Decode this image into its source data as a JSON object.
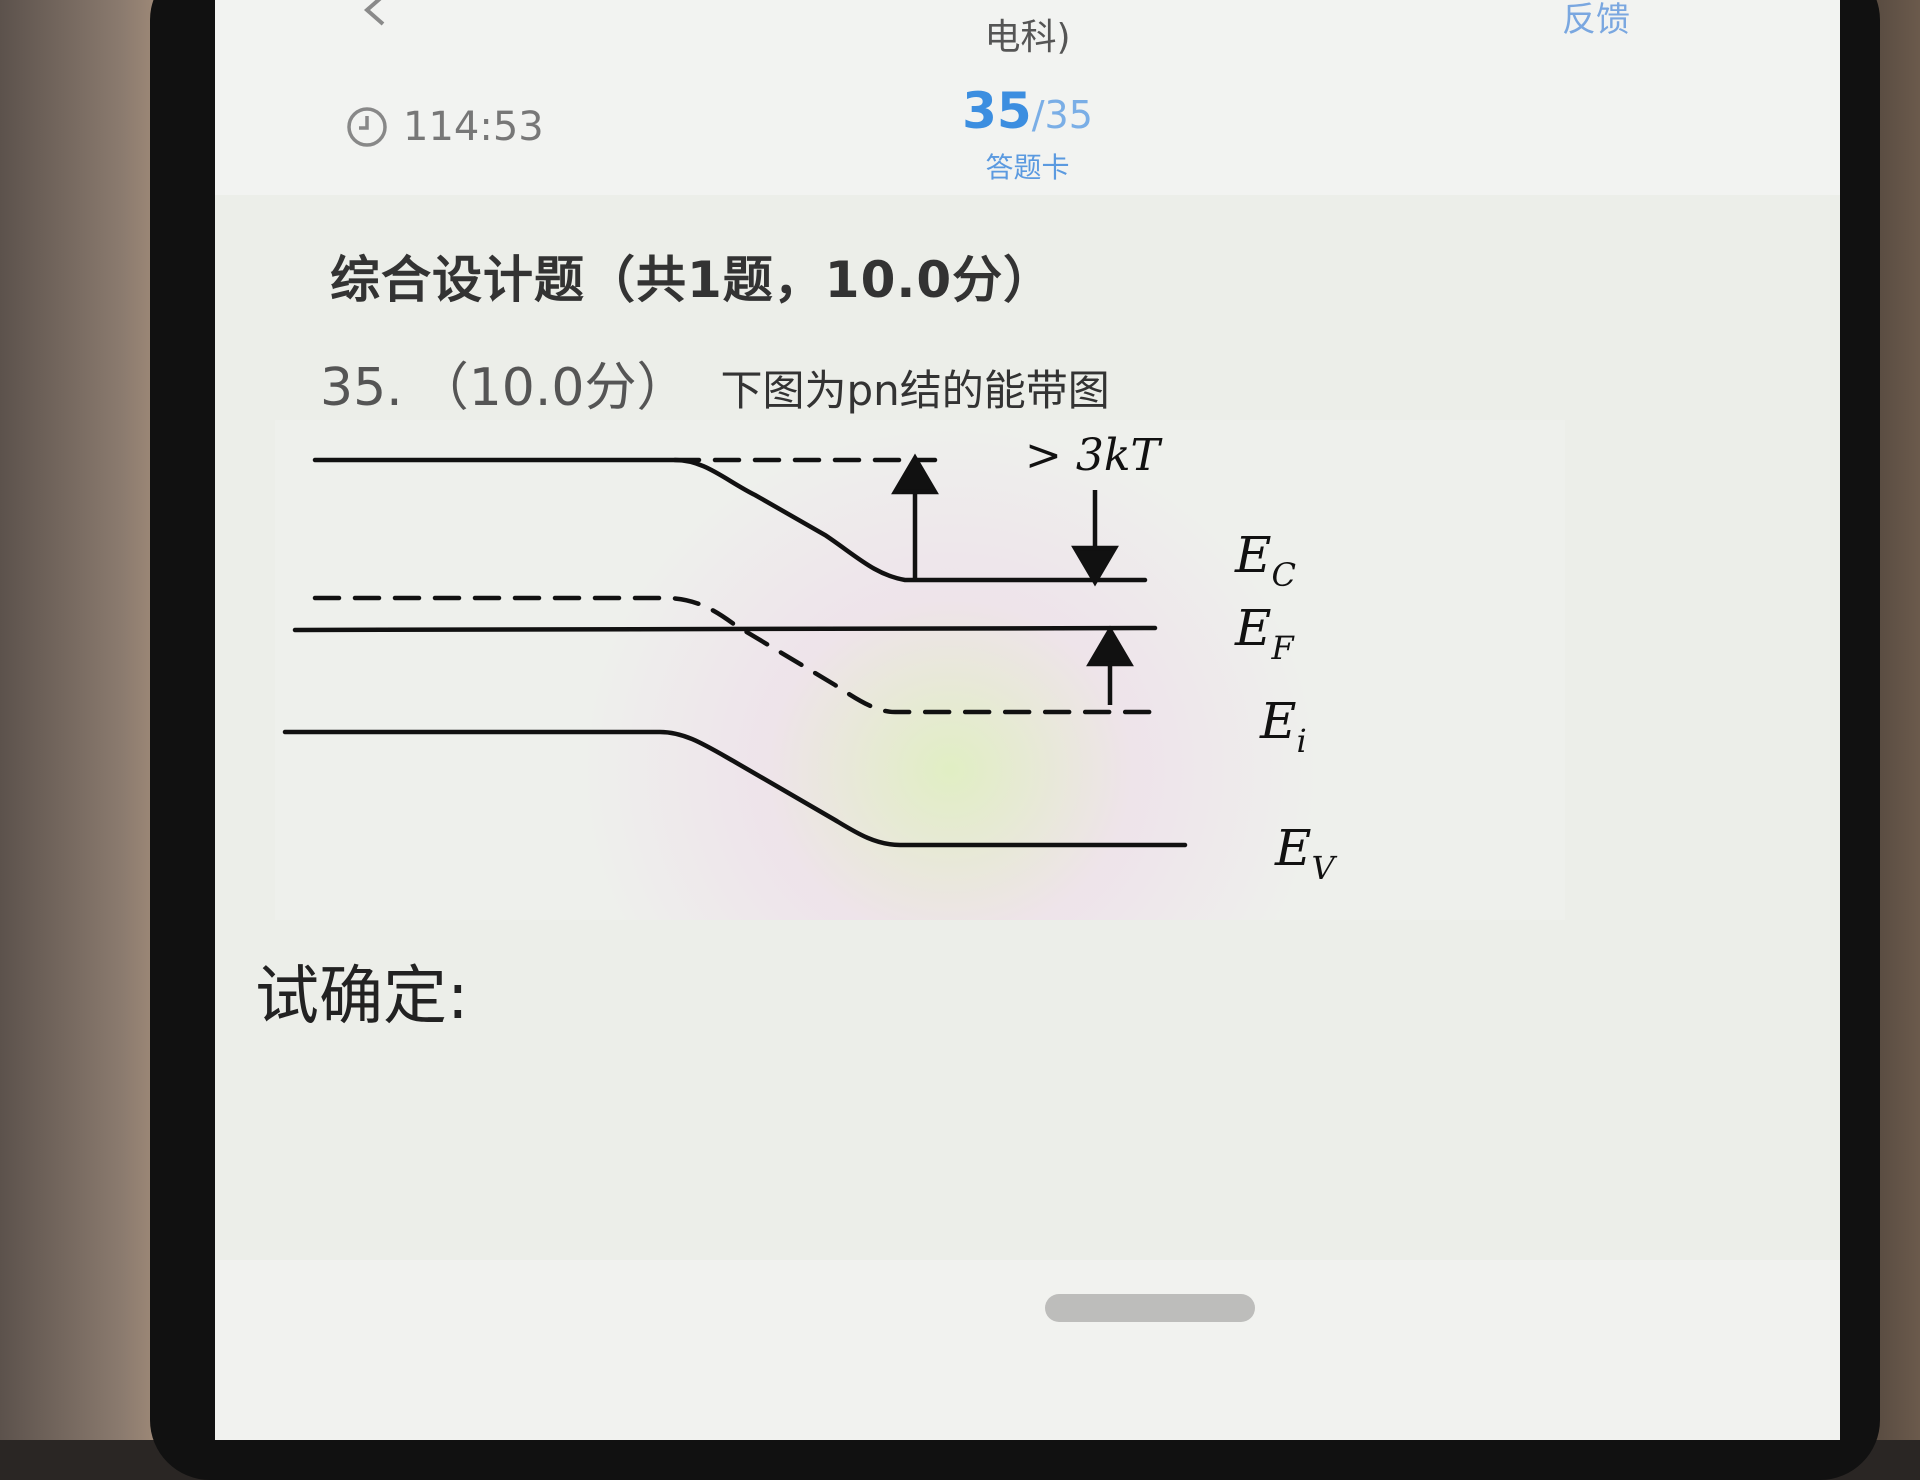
{
  "header": {
    "subtitle": "电科)",
    "feedback_label": "反馈",
    "timer": "114:53",
    "progress_current": "35",
    "progress_separator": "/",
    "progress_total": "35",
    "answer_card_label": "答题卡"
  },
  "section": {
    "title": "综合设计题（共1题，10.0分）"
  },
  "question": {
    "number": "35.",
    "score": "（10.0分）",
    "text": "下图为pn结的能带图",
    "prompt": "试确定:"
  },
  "figure": {
    "annotation": "> 3kT",
    "labels": {
      "ec": "E",
      "ec_sub": "C",
      "ef": "E",
      "ef_sub": "F",
      "ei": "E",
      "ei_sub": "i",
      "ev": "E",
      "ev_sub": "V"
    }
  },
  "icons": {
    "back": "chevron-left-icon",
    "timer": "clock-icon"
  },
  "colors": {
    "accent": "#3c8ee0",
    "text": "#333333"
  }
}
